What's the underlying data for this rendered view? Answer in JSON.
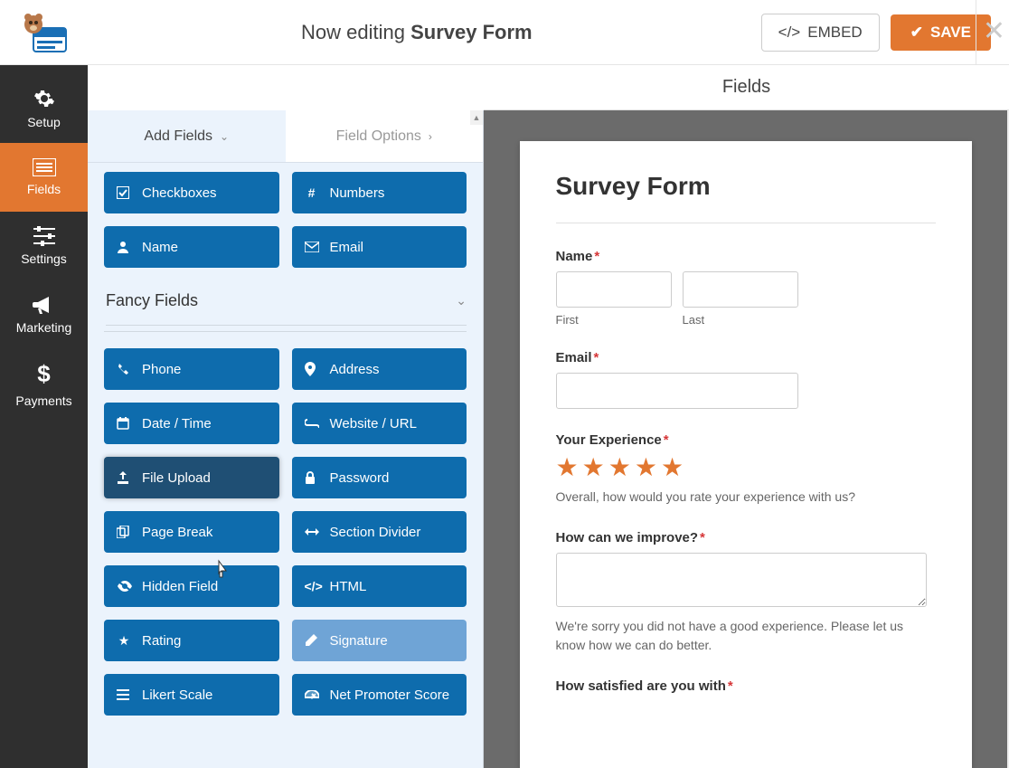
{
  "header": {
    "editing_prefix": "Now editing ",
    "form_name": "Survey Form",
    "embed_label": "EMBED",
    "save_label": "SAVE"
  },
  "leftnav": {
    "items": [
      {
        "label": "Setup"
      },
      {
        "label": "Fields"
      },
      {
        "label": "Settings"
      },
      {
        "label": "Marketing"
      },
      {
        "label": "Payments"
      }
    ]
  },
  "panel_title": "Fields",
  "tabs": {
    "add_fields": "Add Fields",
    "field_options": "Field Options"
  },
  "standard_fields": [
    {
      "icon": "check",
      "label": "Checkboxes"
    },
    {
      "icon": "hash",
      "label": "Numbers"
    },
    {
      "icon": "user",
      "label": "Name"
    },
    {
      "icon": "mail",
      "label": "Email"
    }
  ],
  "fancy_title": "Fancy Fields",
  "fancy_fields": [
    {
      "icon": "phone",
      "label": "Phone"
    },
    {
      "icon": "pin",
      "label": "Address"
    },
    {
      "icon": "cal",
      "label": "Date / Time"
    },
    {
      "icon": "link",
      "label": "Website / URL"
    },
    {
      "icon": "upload",
      "label": "File Upload",
      "hover": true
    },
    {
      "icon": "lock",
      "label": "Password"
    },
    {
      "icon": "copy",
      "label": "Page Break"
    },
    {
      "icon": "arrows",
      "label": "Section Divider"
    },
    {
      "icon": "eye",
      "label": "Hidden Field"
    },
    {
      "icon": "code",
      "label": "HTML"
    },
    {
      "icon": "star",
      "label": "Rating"
    },
    {
      "icon": "pencil",
      "label": "Signature",
      "disabled": true
    },
    {
      "icon": "bars",
      "label": "Likert Scale"
    },
    {
      "icon": "dash",
      "label": "Net Promoter Score"
    }
  ],
  "form": {
    "title": "Survey Form",
    "name_label": "Name",
    "first_label": "First",
    "last_label": "Last",
    "email_label": "Email",
    "exp_label": "Your Experience",
    "exp_desc": "Overall, how would you rate your experience with us?",
    "improve_label": "How can we improve?",
    "improve_desc": "We're sorry you did not have a good experience. Please let us know how we can do better.",
    "satisfied_label": "How satisfied are you with"
  }
}
